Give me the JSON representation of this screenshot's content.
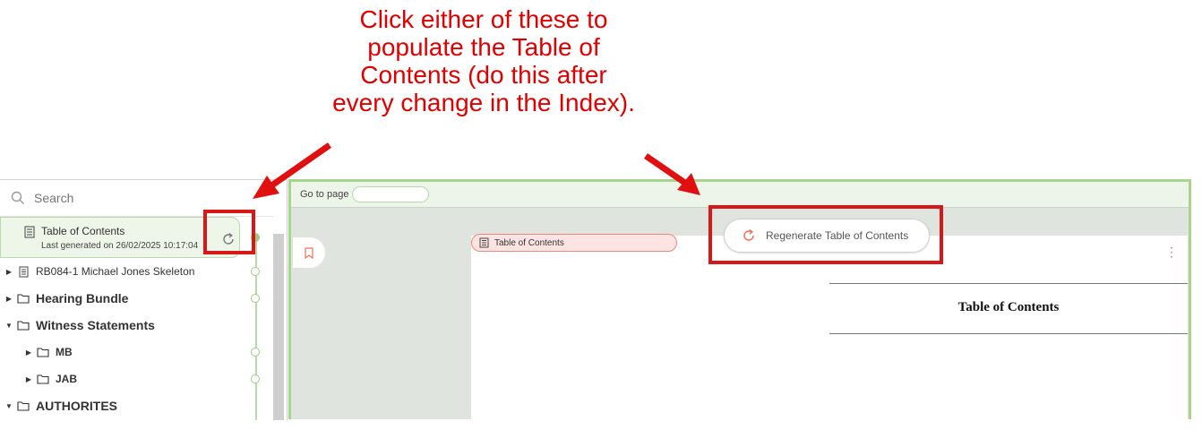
{
  "callout": {
    "lines": [
      "Click either of these to",
      "populate the Table of",
      "Contents (do this after",
      "every change in the Index)."
    ]
  },
  "sidebar": {
    "search_placeholder": "Search",
    "toc_item": {
      "title": "Table of Contents",
      "subtitle": "Last generated on 26/02/2025 10:17:04"
    },
    "items": [
      {
        "label": "RB084-1 Michael Jones Skeleton",
        "icon": "document-icon",
        "expanded": false
      },
      {
        "label": "Hearing Bundle",
        "icon": "folder-icon",
        "expanded": false
      },
      {
        "label": "Witness Statements",
        "icon": "folder-icon",
        "expanded": true
      },
      {
        "label": "MB",
        "icon": "folder-icon",
        "expanded": false
      },
      {
        "label": "JAB",
        "icon": "folder-icon",
        "expanded": false
      },
      {
        "label": "AUTHORITES",
        "icon": "folder-icon",
        "expanded": true
      }
    ]
  },
  "viewer": {
    "goto_label": "Go to page",
    "tab_label": "Table of Contents",
    "regenerate_label": "Regenerate Table of Contents",
    "page_heading": "Table of Contents"
  },
  "colors": {
    "callout": "#e00000",
    "highlight_box": "#d81818",
    "accent_green": "#a8d58c",
    "accent_orange": "#e8735a"
  }
}
